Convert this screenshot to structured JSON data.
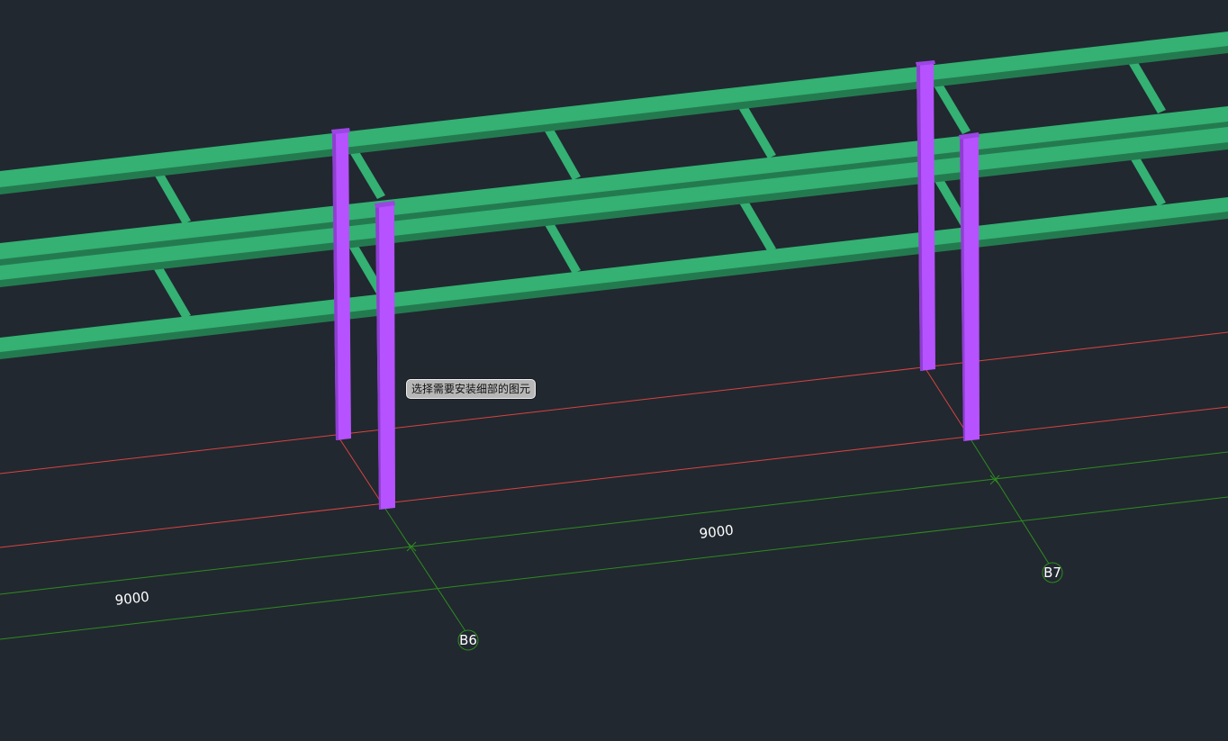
{
  "viewport": {
    "background": "#212830",
    "colors": {
      "beam": "#34b173",
      "beam_shadow": "#247a4f",
      "column": "#b652ff",
      "column_shadow": "#8d3fd0",
      "grid_red": "#d8443f",
      "grid_green": "#2f8b1f"
    }
  },
  "dimensions": [
    {
      "text": "9000"
    },
    {
      "text": "9000"
    }
  ],
  "grid_axes": [
    {
      "label": "B6"
    },
    {
      "label": "B7"
    }
  ],
  "tooltip": {
    "text": "选择需要安装细部的图元"
  }
}
